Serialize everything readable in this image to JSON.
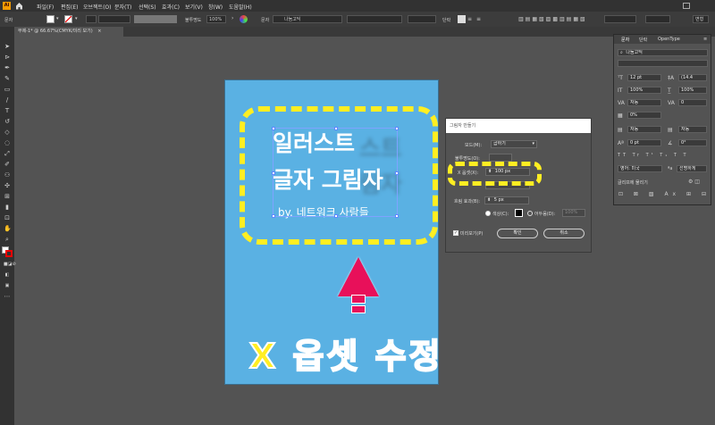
{
  "app": {
    "logo": "Ai",
    "home_icon": "home-icon"
  },
  "menu": [
    "파일(F)",
    "편집(E)",
    "오브젝트(O)",
    "문자(T)",
    "선택(S)",
    "효과(C)",
    "보기(V)",
    "창(W)",
    "도움말(H)"
  ],
  "control_bar": {
    "object_type": "문자",
    "opacity_label": "불투명도",
    "opacity_value": "100%",
    "char_label": "문자",
    "font_name": "나눔고딕",
    "paragraph_label": "단락",
    "align_label": "변형"
  },
  "document_tab": {
    "title": "무제-1* @ 66.67%(CMYK/미리 보기)",
    "close": "×"
  },
  "artboard": {
    "title_line1": "일러스트",
    "title_line2": "글자 그림자",
    "byline": "by. 네트워크 사람들",
    "shadow_line1": "스트",
    "shadow_line2": "림자"
  },
  "caption": "X 옵셋 수정",
  "dialog": {
    "title": "그림자 만들기",
    "mode_label": "모드(M):",
    "mode_value": "곱하기",
    "opacity_label": "불투명도(O):",
    "x_offset_label": "X 옵셋(X):",
    "x_offset_value": "100 px",
    "blur_label": "흐림 효과(B):",
    "blur_value": "5 px",
    "color_label": "색상(C):",
    "darkness_label": "어두움(D):",
    "darkness_value": "100%",
    "preview_label": "미리보기(P)",
    "ok_label": "확인",
    "cancel_label": "취소"
  },
  "char_panel": {
    "tabs": [
      "문자",
      "단락",
      "OpenType"
    ],
    "font_family": "나눔고딕",
    "size": "12 pt",
    "leading": "(14.4",
    "scale_v": "100%",
    "scale_h": "100%",
    "kerning": "자동",
    "tracking": "0",
    "tsume": "0%",
    "aki_left": "자동",
    "aki_right": "자동",
    "baseline": "0 pt",
    "rotation": "0°",
    "language": "영어: 미국",
    "antialias": "선명하게",
    "snap_label": "글리프에 물리기"
  },
  "colors": {
    "artboard_bg": "#5ab1e3",
    "highlight": "#ffee22",
    "arrow": "#e8105a",
    "workspace": "#535353"
  }
}
